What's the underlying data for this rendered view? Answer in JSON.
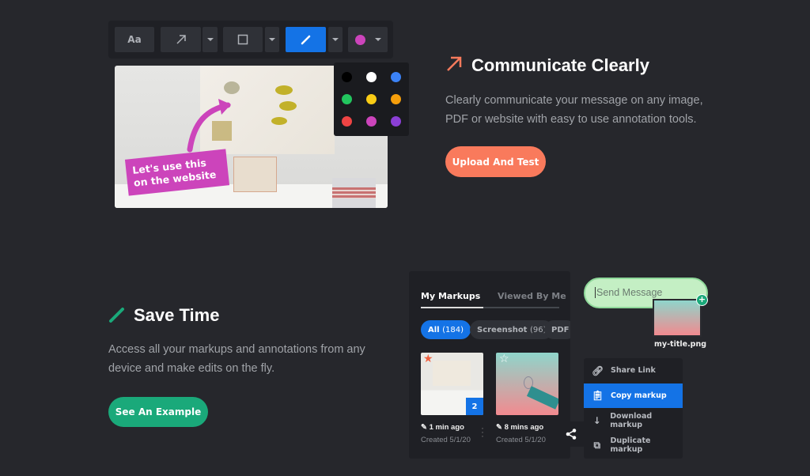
{
  "toolbar": {
    "text_label": "Aa",
    "tools": [
      "text-tool",
      "arrow-tool",
      "rectangle-tool",
      "pen-tool",
      "color-picker"
    ],
    "active_tool": "pen-tool",
    "active_color": "#cc44bb",
    "accent": "#1473e6"
  },
  "palette": {
    "colors": [
      "#000000",
      "#ffffff",
      "#3b82f6",
      "#22c55e",
      "#facc15",
      "#f59e0b",
      "#ef4444",
      "#cc44bb",
      "#8b3fd6"
    ]
  },
  "photo": {
    "annotation_text": "Let's use this on the website"
  },
  "communicate": {
    "title": "Communicate Clearly",
    "description_line1": "Clearly communicate your message on any image,",
    "description_line2": "PDF or website with easy to use annotation tools.",
    "button": "Upload And Test",
    "accent": "#f97a5c"
  },
  "save_time": {
    "title": "Save Time",
    "description_line1": "Access all your markups and annotations from any",
    "description_line2": "device and make edits on the fly.",
    "button": "See An Example",
    "accent": "#1aa97a"
  },
  "markups": {
    "tabs": [
      "My Markups",
      "Viewed By Me"
    ],
    "active_tab": "My Markups",
    "filters": [
      {
        "label": "All",
        "count": "(184)"
      },
      {
        "label": "Screenshot",
        "count": "(96)"
      },
      {
        "label": "PDF",
        "count": ""
      }
    ],
    "items": [
      {
        "edited": "1 min ago",
        "created": "Created 5/1/20",
        "starred": true,
        "badge": "2"
      },
      {
        "edited": "8 mins ago",
        "created": "Created 5/1/20",
        "starred": false
      }
    ]
  },
  "message": {
    "placeholder": "Send Message",
    "attachment": "my-title.png"
  },
  "share_menu": {
    "items": [
      "Share Link",
      "Copy markup",
      "Download markup",
      "Duplicate markup"
    ],
    "selected": "Copy markup"
  }
}
